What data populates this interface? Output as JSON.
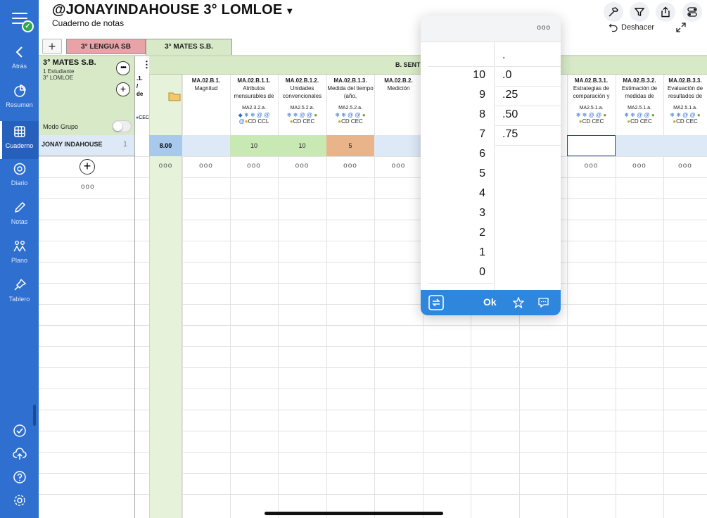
{
  "app": {
    "title": "@JONAYINDAHOUSE 3° LOMLOE",
    "subtitle": "Cuaderno de notas",
    "undo_label": "Deshacer"
  },
  "sidebar": {
    "items": [
      {
        "label": "Atrás"
      },
      {
        "label": "Resumen"
      },
      {
        "label": "Cuaderno"
      },
      {
        "label": "Diario"
      },
      {
        "label": "Notas"
      },
      {
        "label": "Plano"
      },
      {
        "label": "Tablero"
      }
    ],
    "badge": "✓"
  },
  "tabs": [
    {
      "label": "3° LENGUA SB"
    },
    {
      "label": "3° MATES S.B."
    }
  ],
  "group": {
    "name": "3° MATES S.B.",
    "students": "1 Estudiante",
    "level": "3° LOMLOE",
    "mode_label": "Modo Grupo"
  },
  "section": {
    "label": "B. SENTIDO",
    "partial": ".1.\n/\nde"
  },
  "student": {
    "name": "JONAY INDAHOUSE",
    "number": "1",
    "average": "8.00"
  },
  "criteria": [
    {
      "id": "MA.02.B.1.",
      "desc": "Magnitud",
      "code": "",
      "comp": "",
      "grade": ""
    },
    {
      "id": "MA.02.B.1.1.",
      "desc": "Atributos mensurables de",
      "code": "MA2.3.2.a.",
      "comp": "CD CCL",
      "grade": "10"
    },
    {
      "id": "MA.02.B.1.2.",
      "desc": "Unidades convencionales",
      "code": "MA2.5.2.a.",
      "comp": "CD CEC",
      "grade": "10"
    },
    {
      "id": "MA.02.B.1.3.",
      "desc": "Medida del tiempo (año,",
      "code": "MA2.5.2.a.",
      "comp": "CD CEC",
      "grade": "5"
    },
    {
      "id": "MA.02.B.2.",
      "desc": "Medición",
      "code": "",
      "comp": "",
      "grade": ""
    },
    {
      "id": "MA.02.B.3.1.",
      "desc": "Estrategias de comparación y",
      "code": "MA2.5.1.a.",
      "comp": "CD CEC",
      "grade": ""
    },
    {
      "id": "MA.02.B.3.2.",
      "desc": "Estimación de medidas de",
      "code": "MA2.5.1.a.",
      "comp": "CD CEC",
      "grade": ""
    },
    {
      "id": "MA.02.B.3.3.",
      "desc": "Evaluación de resultados de",
      "code": "MA2.5.1.a.",
      "comp": "CD CEC",
      "grade": ""
    }
  ],
  "partial_comp": "CEC",
  "picker": {
    "integers": [
      "10",
      "9",
      "8",
      "7",
      "6",
      "5",
      "4",
      "3",
      "2",
      "1",
      "0"
    ],
    "decimals": [
      ".",
      ".0",
      ".25",
      ".50",
      ".75"
    ],
    "ok_label": "Ok",
    "more": "ooo"
  },
  "colors": {
    "sidebar": "#2f6fcf",
    "accent": "#2f86dd",
    "grade_high": "#c8e8b4",
    "grade_mid": "#e9b48a",
    "average_cell": "#a8c8ec"
  }
}
